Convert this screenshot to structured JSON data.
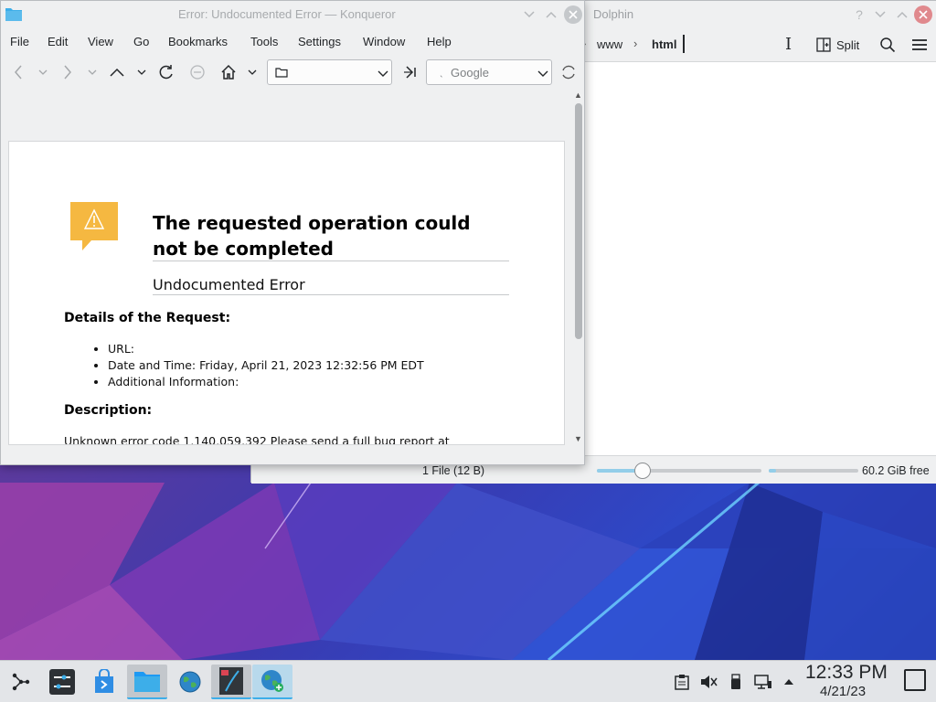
{
  "dolphin": {
    "title": "Dolphin",
    "breadcrumb": [
      "www",
      "html"
    ],
    "split_label": "Split",
    "status_text": "1 File (12 B)",
    "free_space": "60.2 GiB free",
    "zoom_level": 0.28,
    "space_used": 0.08
  },
  "konqueror": {
    "title": "Error: Undocumented Error — Konqueror",
    "menu": [
      "File",
      "Edit",
      "View",
      "Go",
      "Bookmarks",
      "Tools",
      "Settings",
      "Window",
      "Help"
    ],
    "search_placeholder": "Google",
    "error": {
      "title": "The requested operation could not be completed",
      "subtitle": "Undocumented Error",
      "details_heading": "Details of the Request:",
      "details": [
        "URL:",
        "Date and Time: Friday, April 21, 2023 12:32:56 PM EDT",
        "Additional Information:"
      ],
      "description_heading": "Description:",
      "description": "Unknown error code 1,140,059,392 Please send a full bug report at"
    }
  },
  "taskbar": {
    "clock_time": "12:33 PM",
    "clock_date": "4/21/23"
  },
  "colors": {
    "accent": "#3daee9",
    "warning": "#f5b841"
  }
}
